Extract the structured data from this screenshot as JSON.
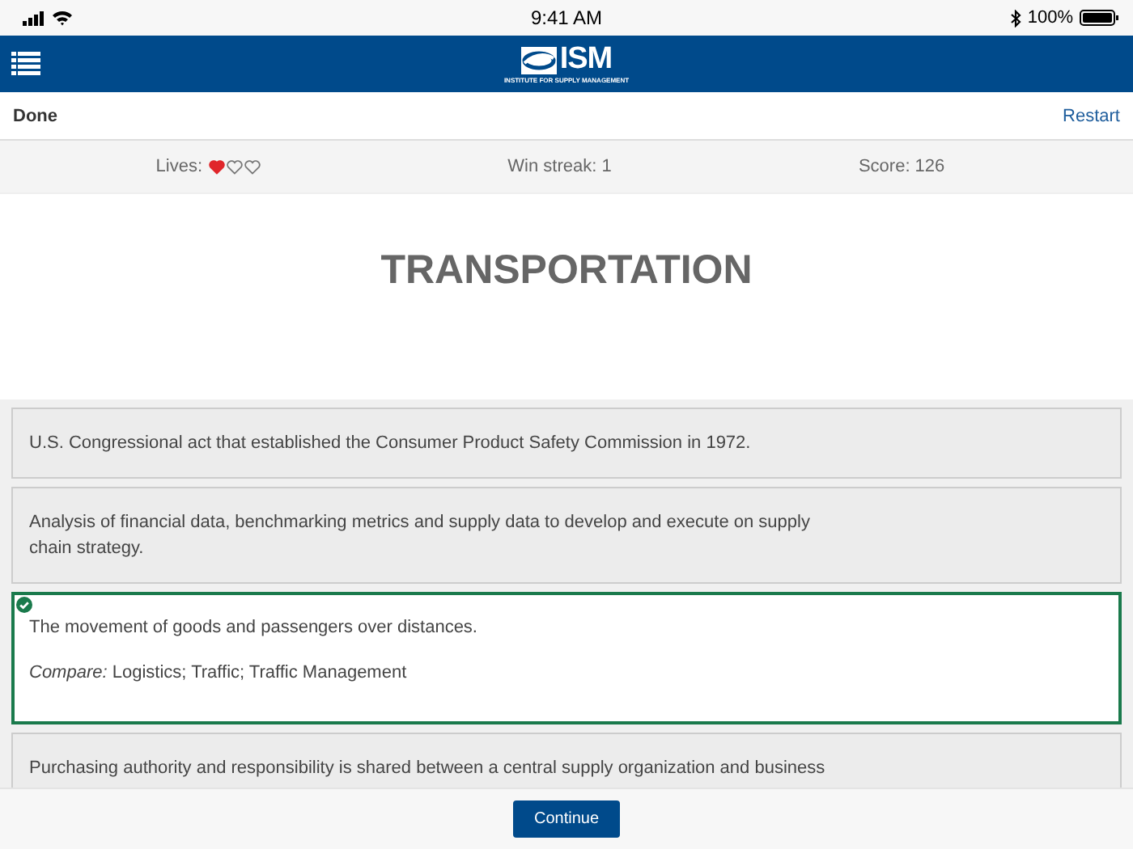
{
  "status_bar": {
    "time": "9:41 AM",
    "battery": "100%"
  },
  "header": {
    "logo": "ISM",
    "logo_subtitle": "INSTITUTE FOR SUPPLY MANAGEMENT"
  },
  "toolbar": {
    "left": "Done",
    "right": "Restart"
  },
  "stats": {
    "lives_label": "Lives:",
    "lives": [
      {
        "filled": true
      },
      {
        "filled": false
      },
      {
        "filled": false
      }
    ],
    "streak": "Win streak: 1",
    "score": "Score: 126"
  },
  "term": "TRANSPORTATION",
  "answers": [
    {
      "text": "U.S. Congressional act that established the Consumer Product Safety Commission in 1972.",
      "selected": false
    },
    {
      "text": "Analysis of financial data, benchmarking metrics and supply data to develop and execute on supply chain strategy.",
      "selected": false
    },
    {
      "text": "The movement of goods and passengers over distances.",
      "compare_label": "Compare:",
      "compare": "Logistics; Traffic; Traffic Management",
      "selected": true
    },
    {
      "text": "Purchasing authority and responsibility is shared between a central supply organization and business",
      "selected": false
    }
  ],
  "button": "Continue"
}
